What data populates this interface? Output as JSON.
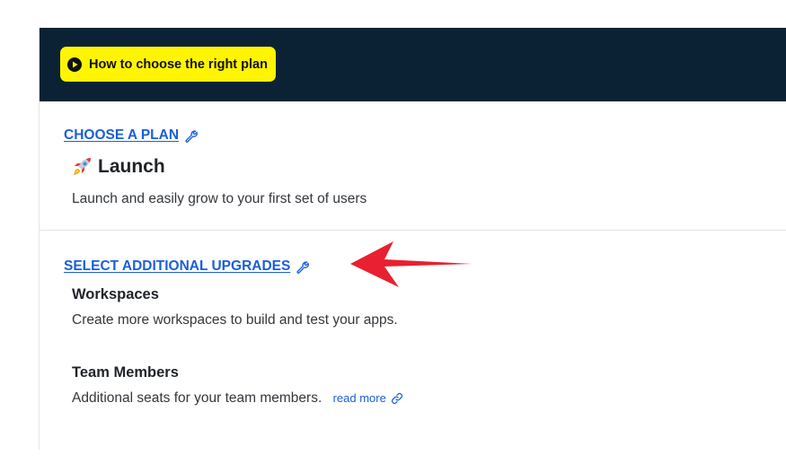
{
  "banner": {
    "video_button_label": "How to choose the right plan",
    "background_color": "#0b2235",
    "button_color": "#fff500"
  },
  "plan_section": {
    "link_label": "CHOOSE A PLAN",
    "plan_icon": "rocket-icon",
    "plan_name": "Launch",
    "plan_description": "Launch and easily grow to your first set of users"
  },
  "upgrades_section": {
    "link_label": "SELECT ADDITIONAL UPGRADES",
    "items": [
      {
        "title": "Workspaces",
        "description": "Create more workspaces to build and test your apps."
      },
      {
        "title": "Team Members",
        "description": "Additional seats for your team members.",
        "link_label": "read more"
      }
    ]
  },
  "colors": {
    "link": "#1a5fd6",
    "annotation_arrow": "#e8202f"
  }
}
